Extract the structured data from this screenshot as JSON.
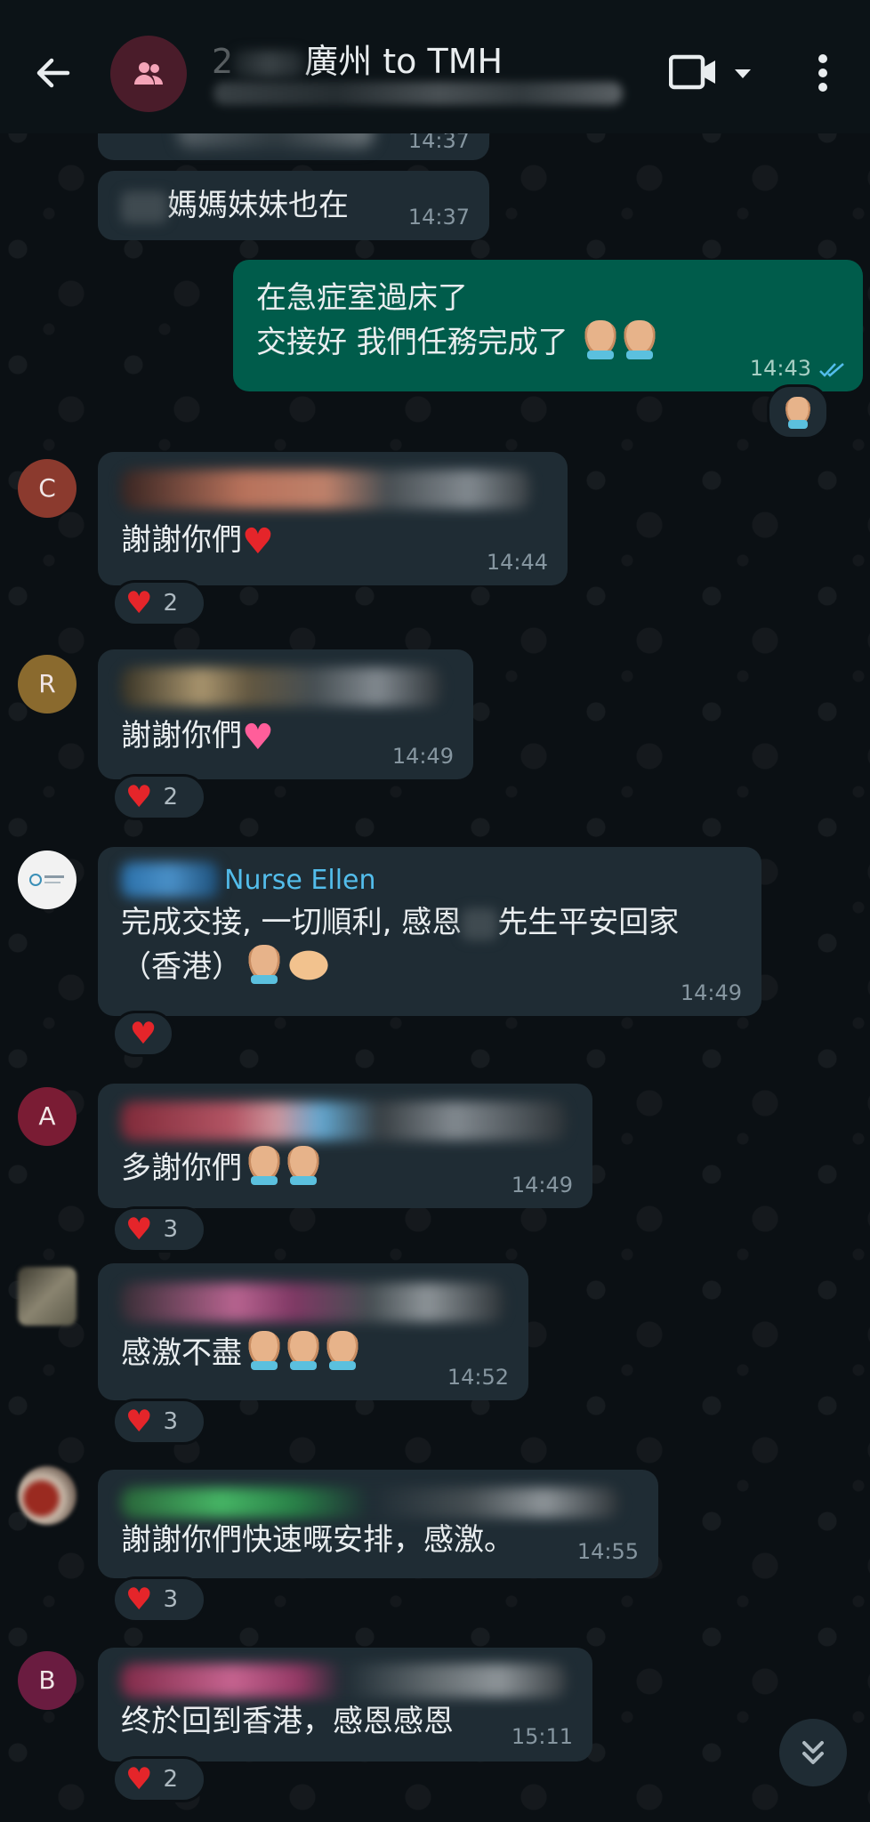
{
  "header": {
    "title": "廣州 to TMH",
    "title_prefix": "2",
    "subtitle_blurred": true
  },
  "messages": [
    {
      "id": "m0",
      "type": "incoming",
      "text": "",
      "time": "14:37"
    },
    {
      "id": "m1",
      "type": "incoming",
      "text": "媽媽妹妹也在",
      "time": "14:37"
    },
    {
      "id": "m2",
      "type": "outgoing",
      "lines": [
        "在急症室過床了",
        "交接好 我們任務完成了"
      ],
      "time": "14:43",
      "reaction_icon": "pray-emoji"
    },
    {
      "id": "m3",
      "type": "incoming",
      "avatar": "C",
      "text": "謝謝你們",
      "emoji": "red-heart-emoji",
      "time": "14:44",
      "reaction": {
        "icon": "red-heart",
        "count": "2"
      }
    },
    {
      "id": "m4",
      "type": "incoming",
      "avatar": "R",
      "text": "謝謝你們",
      "emoji": "pink-heart-emoji",
      "time": "14:49",
      "reaction": {
        "icon": "red-heart",
        "count": "2"
      }
    },
    {
      "id": "m5",
      "type": "incoming",
      "avatar_image": "One Stop Medical Services logo",
      "sender": "Nurse Ellen",
      "line1_a": "完成交接, 一切順利, 感恩",
      "line1_b": "先生平安回家",
      "line2": "（香港）",
      "time": "14:49",
      "reaction": {
        "icon": "red-heart",
        "count": ""
      }
    },
    {
      "id": "m6",
      "type": "incoming",
      "avatar": "A",
      "text": "多謝你們",
      "time": "14:49",
      "reaction": {
        "icon": "red-heart",
        "count": "3"
      }
    },
    {
      "id": "m7",
      "type": "incoming",
      "text": "感激不盡",
      "time": "14:52",
      "reaction": {
        "icon": "red-heart",
        "count": "3"
      }
    },
    {
      "id": "m8",
      "type": "incoming",
      "text": "謝謝你們快速嘅安排，感激。",
      "time": "14:55",
      "reaction": {
        "icon": "red-heart",
        "count": "3"
      }
    },
    {
      "id": "m9",
      "type": "incoming",
      "avatar": "B",
      "text": "终於回到香港，感恩感恩",
      "time": "15:11",
      "reaction": {
        "icon": "red-heart",
        "count": "2"
      }
    }
  ],
  "colors": {
    "incoming_bubble": "#1f2c34",
    "outgoing_bubble": "#005c4b",
    "sender_link": "#53bdeb",
    "read_ticks": "#53bdeb",
    "background": "#0b1014"
  }
}
